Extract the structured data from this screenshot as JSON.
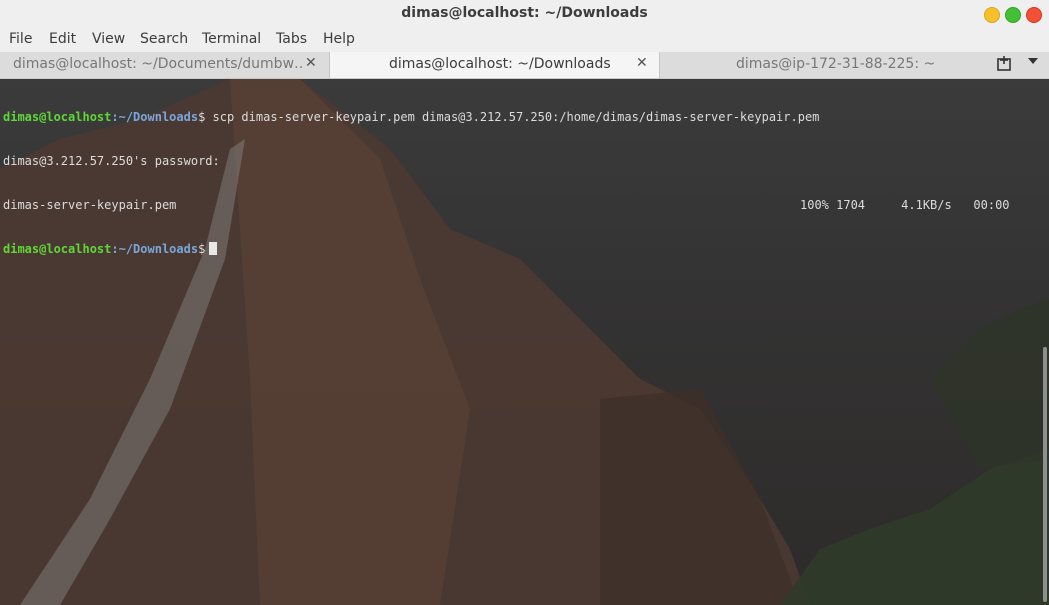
{
  "window": {
    "title": "dimas@localhost: ~/Downloads"
  },
  "menu": {
    "items": [
      "File",
      "Edit",
      "View",
      "Search",
      "Terminal",
      "Tabs",
      "Help"
    ]
  },
  "tabs": [
    {
      "label": "dimas@localhost: ~/Documents/dumbw…",
      "active": false
    },
    {
      "label": "dimas@localhost: ~/Downloads",
      "active": true
    },
    {
      "label": "dimas@ip-172-31-88-225: ~",
      "active": false
    }
  ],
  "tab_close_glyph": "✕",
  "terminal": {
    "lines": [
      {
        "user_host": "dimas@localhost",
        "path": ":~/Downloads",
        "symbol": "$",
        "command": " scp dimas-server-keypair.pem dimas@3.212.57.250:/home/dimas/dimas-server-keypair.pem"
      },
      {
        "text": "dimas@3.212.57.250's password:"
      },
      {
        "text": "dimas-server-keypair.pem",
        "stats": "100% 1704     4.1KB/s   00:00"
      },
      {
        "user_host": "dimas@localhost",
        "path": ":~/Downloads",
        "symbol": "$",
        "command": ""
      }
    ]
  },
  "colors": {
    "prompt_user": "#5fd737",
    "prompt_path": "#7aa6da",
    "close_button": "#f14f36",
    "maximize_button": "#43c036",
    "minimize_button": "#f6c02d"
  },
  "icons": {
    "new_tab": "new-tab-icon",
    "tab_menu": "chevron-down-icon"
  }
}
